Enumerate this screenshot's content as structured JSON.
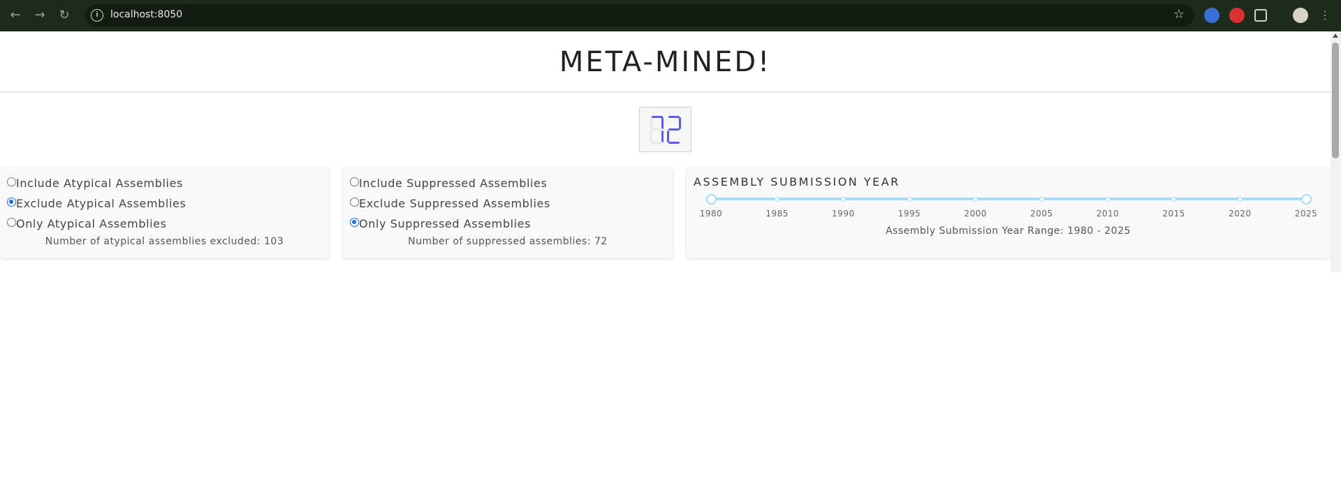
{
  "browser": {
    "url": "localhost:8050",
    "back_icon": "arrow-left-icon",
    "forward_icon": "arrow-right-icon",
    "reload_icon": "reload-icon"
  },
  "header": {
    "title": "META-MINED!"
  },
  "counter": {
    "value": "72",
    "color": "#5b5bea"
  },
  "atypical": {
    "options": [
      "Include Atypical Assemblies",
      "Exclude Atypical Assemblies",
      "Only Atypical Assemblies"
    ],
    "selected": "Exclude Atypical Assemblies",
    "note": "Number of atypical assemblies excluded: 103"
  },
  "suppressed": {
    "options": [
      "Include Suppressed Assemblies",
      "Exclude Suppressed Assemblies",
      "Only Suppressed Assemblies"
    ],
    "selected": "Only Suppressed Assemblies",
    "note": "Number of suppressed assemblies: 72"
  },
  "year_slider": {
    "title": "ASSEMBLY SUBMISSION YEAR",
    "marks": [
      "1980",
      "1985",
      "1990",
      "1995",
      "2000",
      "2005",
      "2010",
      "2015",
      "2020",
      "2025"
    ],
    "range": [
      1980,
      2025
    ],
    "note": "Assembly Submission Year Range: 1980 - 2025",
    "color": "#a6dcf4"
  }
}
